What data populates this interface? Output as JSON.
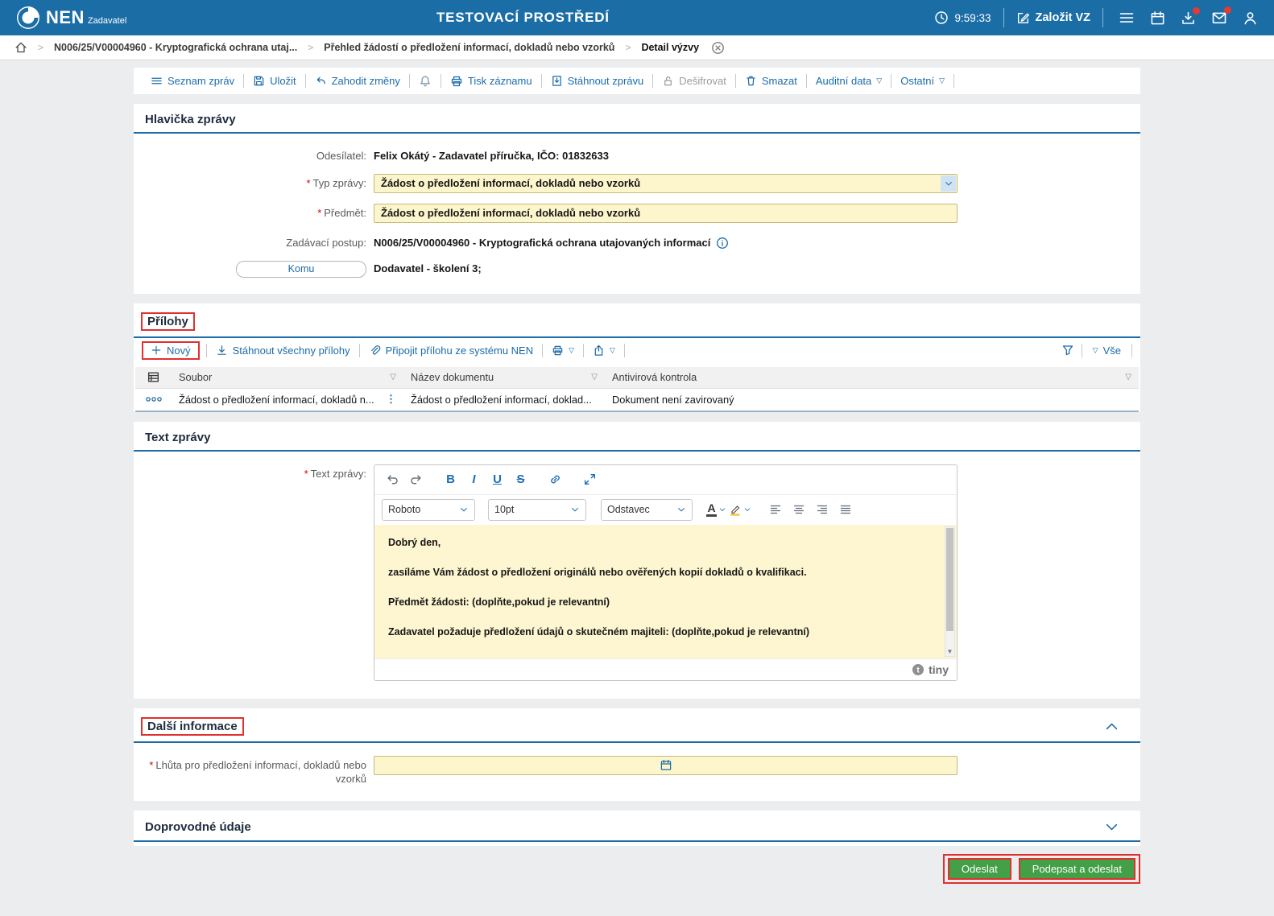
{
  "colors": {
    "header_blue": "#1b6da6",
    "link_blue": "#1b6ca8",
    "input_yellow": "#fdf5cc",
    "button_green": "#43a047",
    "annotation_red": "#e0312f"
  },
  "icons": {
    "req": "*",
    "caret": "▽",
    "kebab": "⋮",
    "crumb_sep": ">",
    "scroll_down": "▼"
  },
  "header": {
    "brand": "NEN",
    "brand_sub": "Zadavatel",
    "env_title": "TESTOVACÍ PROSTŘEDÍ",
    "time": "9:59:33",
    "zalozit_vz": "Založit VZ"
  },
  "breadcrumb": {
    "item1": "N006/25/V00004960 - Kryptografická ochrana utaj...",
    "item2": "Přehled žádostí o předložení informací, dokladů nebo vzorků",
    "item3": "Detail výzvy"
  },
  "toolbar": {
    "seznam_zprav": "Seznam zpráv",
    "ulozit": "Uložit",
    "zahodit_zmeny": "Zahodit změny",
    "tisk_zaznamu": "Tisk záznamu",
    "stahnout_zpravu": "Stáhnout zprávu",
    "desifrovat": "Dešifrovat",
    "smazat": "Smazat",
    "auditni_data": "Auditní data",
    "ostatni": "Ostatní"
  },
  "hlavicka": {
    "title": "Hlavička zprávy",
    "odesilatel_label": "Odesílatel:",
    "odesilatel_value": "Felix Okátý - Zadavatel příručka, IČO: 01832633",
    "typ_label": "Typ zprávy:",
    "typ_value": "Žádost o předložení informací, dokladů nebo vzorků",
    "predmet_label": "Předmět:",
    "predmet_value": "Žádost o předložení informací, dokladů nebo vzorků",
    "postup_label": "Zadávací postup:",
    "postup_value": "N006/25/V00004960 - Kryptografická ochrana utajovaných informací",
    "komu_label": "Komu",
    "komu_value": "Dodavatel - školení 3;"
  },
  "prilohy": {
    "title": "Přílohy",
    "novy": "Nový",
    "stahnout_vsechny": "Stáhnout všechny přílohy",
    "pripojit": "Připojit přílohu ze systému NEN",
    "vse": "Vše",
    "col_soubor": "Soubor",
    "col_nazev": "Název dokumentu",
    "col_antivir": "Antivirová kontrola",
    "rows": [
      {
        "soubor": "Žádost o předložení informací, dokladů n...",
        "nazev": "Žádost o předložení informací, doklad...",
        "antivir": "Dokument není zavirovaný"
      }
    ]
  },
  "text_zpravy": {
    "title": "Text zprávy",
    "label": "Text zprávy:",
    "font_name": "Roboto",
    "font_size": "10pt",
    "block_format": "Odstavec",
    "paragraphs": [
      "Dobrý den,",
      "zasíláme Vám žádost o předložení originálů nebo ověřených kopií dokladů o kvalifikaci.",
      "Předmět žádosti: (doplňte,pokud je relevantní)",
      "Zadavatel požaduje předložení údajů o skutečném majiteli: (doplňte,pokud je relevantní)"
    ],
    "editor_brand": "tiny"
  },
  "dalsi_informace": {
    "title": "Další informace",
    "lhuta_label": "Lhůta pro předložení informací, dokladů nebo vzorků"
  },
  "doprovodne_udaje": {
    "title": "Doprovodné údaje"
  },
  "actions": {
    "odeslat": "Odeslat",
    "podepsat_a_odeslat": "Podepsat a odeslat"
  }
}
